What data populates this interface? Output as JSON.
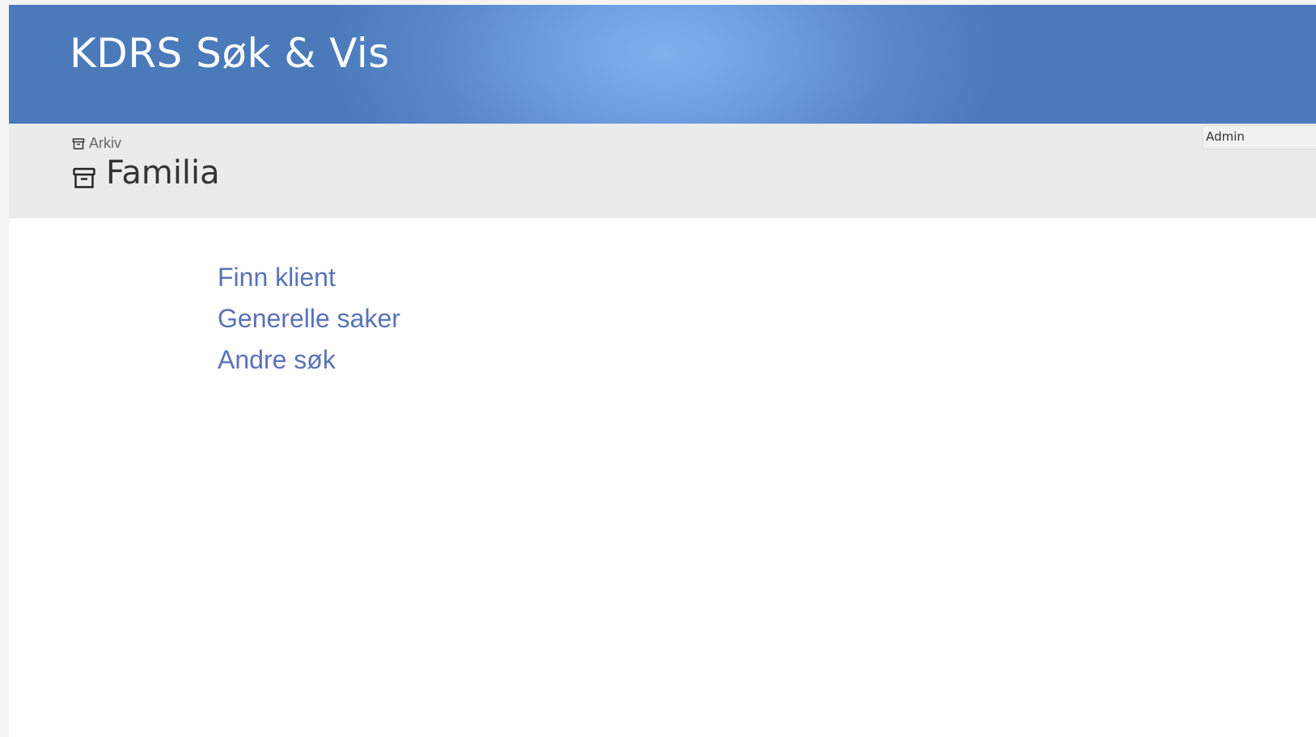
{
  "header": {
    "app_title": "KDRS Søk & Vis",
    "colors": {
      "gradient_center": "#7fb0ee",
      "gradient_edge": "#4b7aba"
    }
  },
  "subheader": {
    "breadcrumb": {
      "icon": "archive-box-icon",
      "label": "Arkiv"
    },
    "page_title": {
      "icon": "archive-box-icon",
      "label": "Familia"
    },
    "admin_button": {
      "label": "Admin"
    }
  },
  "main": {
    "links": [
      {
        "label": "Finn klient"
      },
      {
        "label": "Generelle saker"
      },
      {
        "label": "Andre søk"
      }
    ],
    "link_color": "#5a72b8"
  }
}
